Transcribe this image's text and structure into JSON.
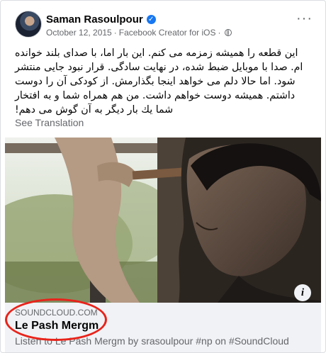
{
  "post": {
    "author": "Saman Rasoulpour",
    "verified_icon": "verified-badge-icon",
    "date": "October 12, 2015",
    "separator": "·",
    "source": "Facebook Creator for iOS",
    "privacy_icon": "globe-icon",
    "more_icon": "more-options-icon",
    "more_label": "···",
    "text": "این قطعه را همیشه زمزمه می کنم. این بار اما، با صدای بلند خوانده ام. صدا با موبایل ضبط شده، در نهایت سادگی. قرار نبود جایی منتشر شود. اما حالا دلم می خواهد اینجا بگذارمش. از کودکی آن را دوست داشتم. همیشه دوست خواهم داشت. من هم همراه شما و به افتخار شما یك بار دیگر به آن گوش می دهم!",
    "see_translation": "See Translation"
  },
  "link": {
    "info_label": "i",
    "domain": "SOUNDCLOUD.COM",
    "title": "Le Pash Mergm",
    "description": "Listen to Le Pash Mergm by srasoulpour #np on #SoundCloud"
  },
  "colors": {
    "verified_blue": "#1877f2",
    "annotation_red": "#e8231a",
    "secondary_text": "#65676b",
    "link_box_bg": "#f0f2f5"
  }
}
